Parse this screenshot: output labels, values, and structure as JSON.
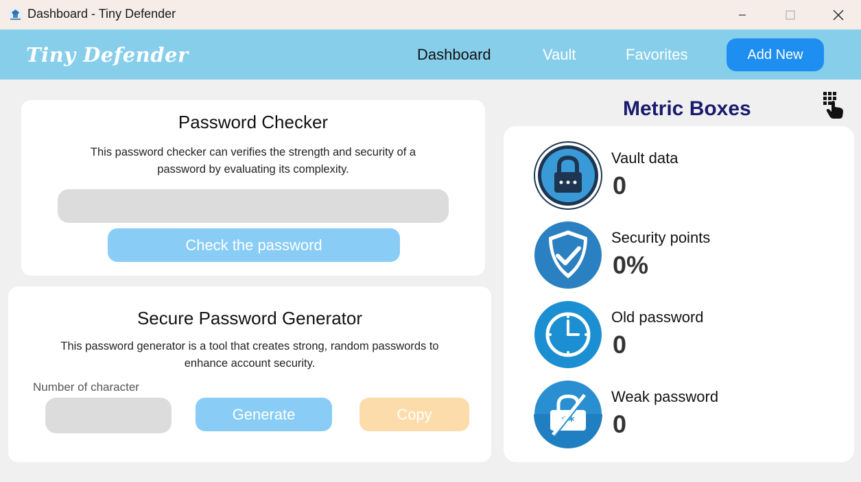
{
  "window": {
    "title": "Dashboard - Tiny Defender"
  },
  "nav": {
    "brand": "Tiny Defender",
    "links": [
      "Dashboard",
      "Vault",
      "Favorites"
    ],
    "add_new": "Add New",
    "active_color": "#111111",
    "bar_color": "#87ceeb"
  },
  "checker": {
    "title": "Password Checker",
    "desc_line1": "This password checker can verifies the strength and security of a",
    "desc_line2": "password by evaluating its complexity.",
    "input_value": "",
    "button": "Check the password"
  },
  "generator": {
    "title": "Secure Password Generator",
    "desc_line1": "This password generator is a tool that creates strong, random passwords to",
    "desc_line2": "enhance account security.",
    "number_label": "Number of character",
    "number_value": "",
    "generate_button": "Generate",
    "copy_button": "Copy"
  },
  "metrics": {
    "heading": "Metric Boxes",
    "items": [
      {
        "label": "Vault data",
        "value": "0",
        "icon": "padlock-icon"
      },
      {
        "label": "Security points",
        "value": "0%",
        "icon": "shield-check-icon"
      },
      {
        "label": "Old password",
        "value": "0",
        "icon": "clock-icon"
      },
      {
        "label": "Weak password",
        "value": "0",
        "icon": "broken-lock-icon"
      }
    ]
  }
}
